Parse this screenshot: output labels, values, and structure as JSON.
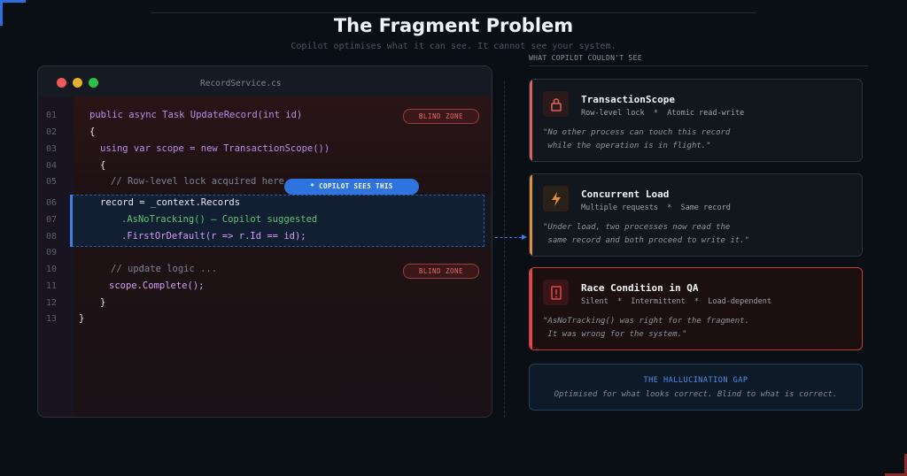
{
  "header": {
    "title": "The Fragment Problem",
    "subtitle": "Copilot optimises what it can see.  It cannot see your system."
  },
  "editor": {
    "filename": "RecordService.cs",
    "blind_zone_label": "BLIND ZONE",
    "copilot_sees_label": "* COPILOT SEES THIS",
    "lines": [
      {
        "num": "01",
        "text": "public async Task UpdateRecord(int id)"
      },
      {
        "num": "02",
        "text": "{"
      },
      {
        "num": "03",
        "text": "using var scope = new TransactionScope())"
      },
      {
        "num": "04",
        "text": "{"
      },
      {
        "num": "05",
        "text": "// Row-level lock acquired here"
      },
      {
        "num": "06",
        "text": "record = _context.Records"
      },
      {
        "num": "07",
        "text": ".AsNoTracking() — Copilot suggested"
      },
      {
        "num": "08",
        "text": ".FirstOrDefault(r => r.Id == id);"
      },
      {
        "num": "09",
        "text": ""
      },
      {
        "num": "10",
        "text": "// update logic ..."
      },
      {
        "num": "11",
        "text": "scope.Complete();"
      },
      {
        "num": "12",
        "text": "}"
      },
      {
        "num": "13",
        "text": "}"
      }
    ]
  },
  "right_panel": {
    "section_label": "WHAT COPILOT COULDN'T SEE",
    "cards": [
      {
        "icon": "lock-icon",
        "title": "TransactionScope",
        "tags": "Row-level lock  *  Atomic read-write",
        "quote": "\"No other process can touch this record\n while the operation is in flight.\"",
        "accent": "#e0605c"
      },
      {
        "icon": "lightning-icon",
        "title": "Concurrent Load",
        "tags": "Multiple requests  *  Same record",
        "quote": "\"Under load, two processes now read the\n same record and both proceed to write it.\"",
        "accent": "#e0903a"
      },
      {
        "icon": "alert-icon",
        "title": "Race Condition in QA",
        "tags": "Silent  *  Intermittent  *  Load-dependent",
        "quote": "\"AsNoTracking() was right for the fragment.\n It was wrong for the system.\"",
        "accent": "#e24a4a"
      }
    ],
    "gap": {
      "title": "THE HALLUCINATION GAP",
      "text": "Optimised for what looks correct.  Blind to what is correct."
    }
  }
}
